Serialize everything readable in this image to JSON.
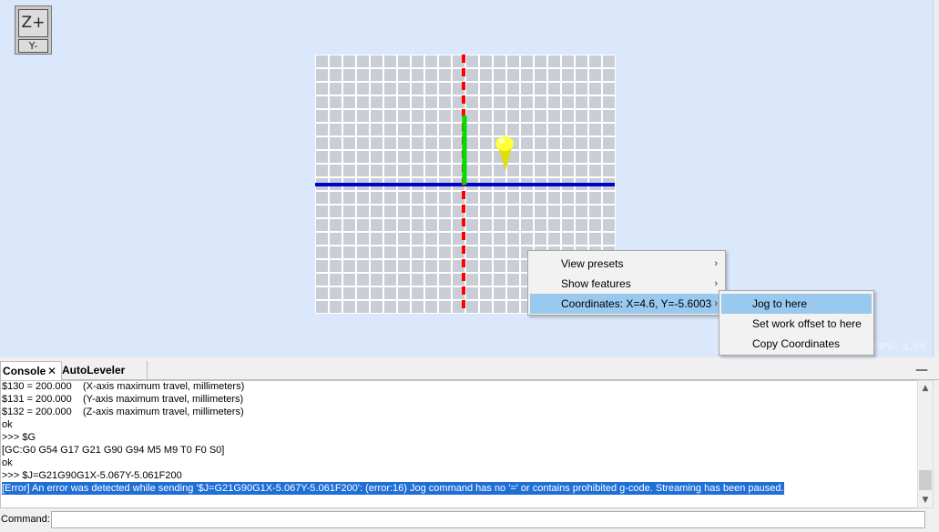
{
  "viewcube": {
    "top_face": "Z+",
    "front_face": "Y-"
  },
  "viewport": {
    "fps_text": "FPS: 3.99"
  },
  "context_menu": {
    "items": [
      {
        "label": "View presets",
        "has_submenu": true
      },
      {
        "label": "Show features",
        "has_submenu": true
      },
      {
        "label": "Coordinates: X=4.6, Y=-5.6003",
        "has_submenu": true,
        "highlighted": true
      }
    ],
    "submenu": [
      {
        "label": "Jog to here",
        "highlighted": true
      },
      {
        "label": "Set work offset to here"
      },
      {
        "label": "Copy Coordinates"
      }
    ]
  },
  "dock": {
    "tabs": [
      {
        "label": "Console",
        "closable": true
      },
      {
        "label": "AutoLeveler"
      }
    ],
    "minimize_label": "—"
  },
  "console": {
    "lines": [
      "$130 = 200.000    (X-axis maximum travel, millimeters)",
      "$131 = 200.000    (Y-axis maximum travel, millimeters)",
      "$132 = 200.000    (Z-axis maximum travel, millimeters)",
      "ok",
      ">>> $G",
      "[GC:G0 G54 G17 G21 G90 G94 M5 M9 T0 F0 S0]",
      "ok",
      ">>> $J=G21G90G1X-5.067Y-5.061F200"
    ],
    "error_line": "[Error] An error was detected while sending '$J=G21G90G1X-5.067Y-5.061F200': (error:16) Jog command has no '=' or contains prohibited g-code. Streaming has been paused."
  },
  "command": {
    "label": "Command:",
    "value": ""
  },
  "colors": {
    "x_axis": "#0000cc",
    "y_axis": "#ff0000",
    "z_axis": "#00dd00",
    "tool": "#ffff33",
    "grid_fill": "#c8cdd6",
    "error_bg": "#1f6fd6"
  },
  "icons": {
    "close": "close-icon",
    "submenu": "chevron-right-icon",
    "scroll_up": "triangle-up-icon",
    "scroll_down": "triangle-down-icon",
    "minimize": "minimize-icon"
  }
}
